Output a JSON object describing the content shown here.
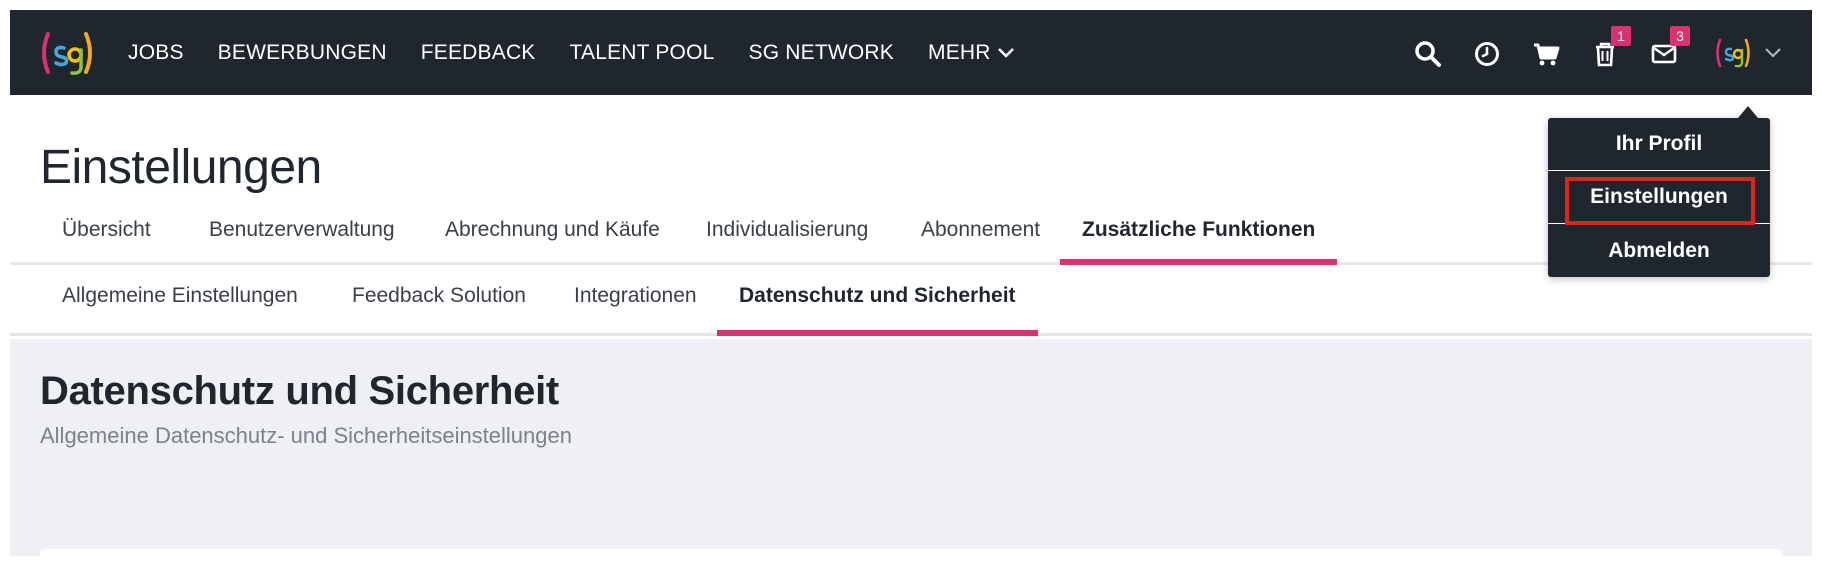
{
  "nav": {
    "links": [
      "JOBS",
      "BEWERBUNGEN",
      "FEEDBACK",
      "TALENT POOL",
      "SG NETWORK",
      "MEHR"
    ],
    "badges": {
      "trash": "1",
      "mail": "3"
    },
    "icons": [
      "search-icon",
      "clock-icon",
      "cart-icon",
      "trash-icon",
      "mail-icon",
      "chevron-down-icon"
    ]
  },
  "dropdown": {
    "items": [
      "Ihr Profil",
      "Einstellungen",
      "Abmelden"
    ]
  },
  "page": {
    "title": "Einstellungen"
  },
  "tabs": [
    "Übersicht",
    "Benutzerverwaltung",
    "Abrechnung und Käufe",
    "Individualisierung",
    "Abonnement",
    "Zusätzliche Funktionen"
  ],
  "subtabs": [
    "Allgemeine Einstellungen",
    "Feedback Solution",
    "Integrationen",
    "Datenschutz und Sicherheit"
  ],
  "section": {
    "title": "Datenschutz und Sicherheit",
    "subtitle": "Allgemeine Datenschutz- und Sicherheitseinstellungen"
  },
  "colors": {
    "navbar": "#1f262d",
    "accent": "#e02f6e",
    "highlight": "#e2231a",
    "content_bg": "#eef0f3"
  }
}
